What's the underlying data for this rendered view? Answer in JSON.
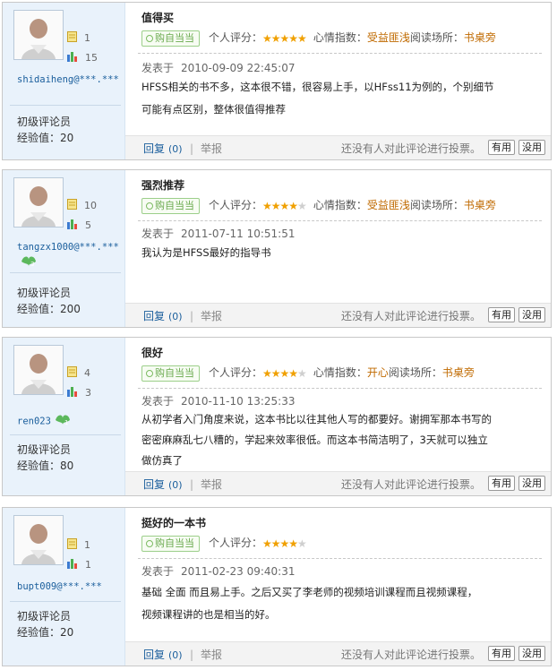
{
  "reviews": [
    {
      "title": "值得买",
      "buy_label": "购自当当",
      "rating_label": "个人评分：",
      "stars": 5,
      "mood_label": "心情指数：",
      "mood": "受益匪浅",
      "place_label": "阅读场所：",
      "place": "书桌旁",
      "posted_label": "发表于",
      "date": "2010-09-09 22:45:07",
      "text_lines": [
        "HFSS相关的书不多，这本很不错，很容易上手，以HFss11为例的，个别细节",
        "可能有点区别，整体很值得推荐"
      ],
      "user": {
        "name": "shidaiheng@***.***",
        "count1": "1",
        "count2": "15",
        "rank": "初级评论员",
        "exp": "经验值：20",
        "badge": ""
      },
      "reply": "回复",
      "reply_count": "(0)",
      "report": "举报",
      "no_vote": "还没有人对此评论进行投票。",
      "useful": "有用",
      "useless": "没用"
    },
    {
      "title": "强烈推荐",
      "buy_label": "购自当当",
      "rating_label": "个人评分：",
      "stars": 4,
      "mood_label": "心情指数：",
      "mood": "受益匪浅",
      "place_label": "阅读场所：",
      "place": "书桌旁",
      "posted_label": "发表于",
      "date": "2011-07-11 10:51:51",
      "text_lines": [
        "我认为是HFSS最好的指导书"
      ],
      "user": {
        "name": "tangzx1000@***.***",
        "count1": "10",
        "count2": "5",
        "rank": "初级评论员",
        "exp": "经验值：200",
        "badge": "3"
      },
      "reply": "回复",
      "reply_count": "(0)",
      "report": "举报",
      "no_vote": "还没有人对此评论进行投票。",
      "useful": "有用",
      "useless": "没用"
    },
    {
      "title": "很好",
      "buy_label": "购自当当",
      "rating_label": "个人评分：",
      "stars": 4,
      "mood_label": "心情指数：",
      "mood": "开心",
      "place_label": "阅读场所：",
      "place": "书桌旁",
      "posted_label": "发表于",
      "date": "2010-11-10 13:25:33",
      "text_lines": [
        "从初学者入门角度来说，这本书比以往其他人写的都要好。谢拥军那本书写的",
        "密密麻麻乱七八糟的，学起来效率很低。而这本书简洁明了，3天就可以独立",
        "做仿真了"
      ],
      "user": {
        "name": "ren023",
        "count1": "4",
        "count2": "3",
        "rank": "初级评论员",
        "exp": "经验值：80",
        "badge": "1"
      },
      "reply": "回复",
      "reply_count": "(0)",
      "report": "举报",
      "no_vote": "还没有人对此评论进行投票。",
      "useful": "有用",
      "useless": "没用"
    },
    {
      "title": "挺好的一本书",
      "buy_label": "购自当当",
      "rating_label": "个人评分：",
      "stars": 4,
      "mood_label": "",
      "mood": "",
      "place_label": "",
      "place": "",
      "posted_label": "发表于",
      "date": "2011-02-23 09:40:31",
      "text_lines": [
        "基础 全面 而且易上手。之后又买了李老师的视频培训课程而且视频课程，",
        "视频课程讲的也是相当的好。"
      ],
      "user": {
        "name": "bupt009@***.***",
        "count1": "1",
        "count2": "1",
        "rank": "初级评论员",
        "exp": "经验值：20",
        "badge": ""
      },
      "reply": "回复",
      "reply_count": "(0)",
      "report": "举报",
      "no_vote": "还没有人对此评论进行投票。",
      "useful": "有用",
      "useless": "没用"
    }
  ]
}
